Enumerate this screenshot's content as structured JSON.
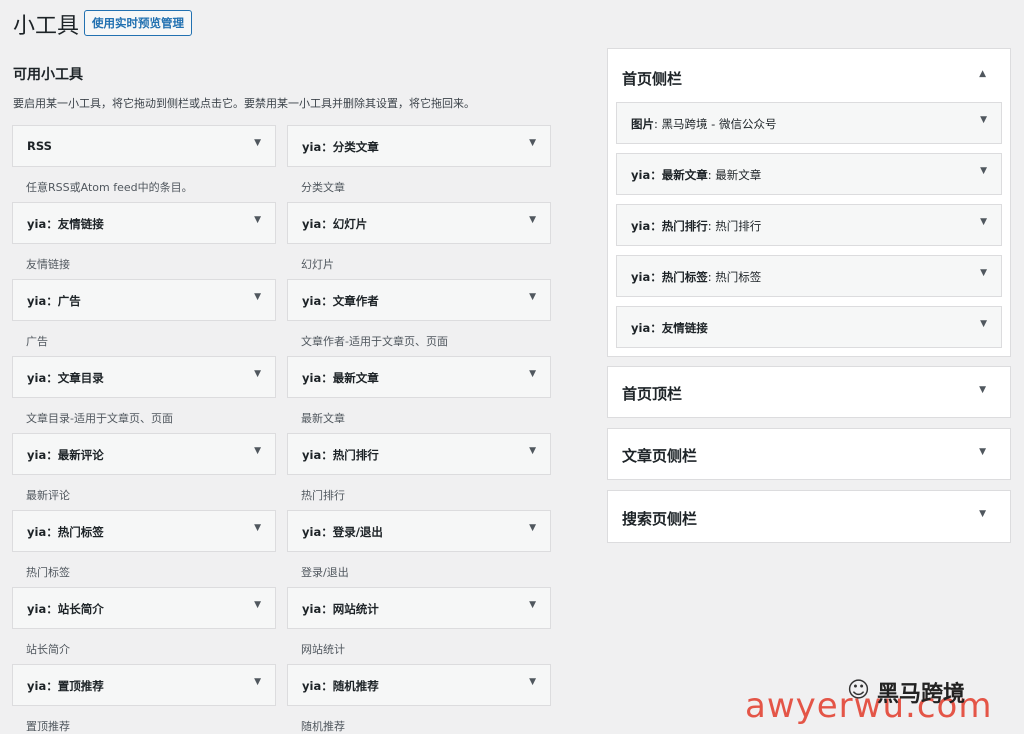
{
  "header": {
    "title": "小工具",
    "preview_button": "使用实时预览管理"
  },
  "available": {
    "title": "可用小工具",
    "description": "要启用某一小工具，将它拖动到侧栏或点击它。要禁用某一小工具并删除其设置，将它拖回来。",
    "widgets": [
      {
        "name": "RSS",
        "desc": "任意RSS或Atom feed中的条目。"
      },
      {
        "name": "yia：分类文章",
        "desc": "分类文章"
      },
      {
        "name": "yia：友情链接",
        "desc": "友情链接"
      },
      {
        "name": "yia：幻灯片",
        "desc": "幻灯片"
      },
      {
        "name": "yia：广告",
        "desc": "广告"
      },
      {
        "name": "yia：文章作者",
        "desc": "文章作者-适用于文章页、页面"
      },
      {
        "name": "yia：文章目录",
        "desc": "文章目录-适用于文章页、页面"
      },
      {
        "name": "yia：最新文章",
        "desc": "最新文章"
      },
      {
        "name": "yia：最新评论",
        "desc": "最新评论"
      },
      {
        "name": "yia：热门排行",
        "desc": "热门排行"
      },
      {
        "name": "yia：热门标签",
        "desc": "热门标签"
      },
      {
        "name": "yia：登录/退出",
        "desc": "登录/退出"
      },
      {
        "name": "yia：站长简介",
        "desc": "站长简介"
      },
      {
        "name": "yia：网站统计",
        "desc": "网站统计"
      },
      {
        "name": "yia：置顶推荐",
        "desc": "置顶推荐"
      },
      {
        "name": "yia：随机推荐",
        "desc": "随机推荐"
      }
    ]
  },
  "sidebars": [
    {
      "title": "首页侧栏",
      "expanded": true,
      "widgets": [
        {
          "name": "图片",
          "title": ": 黑马跨境 - 微信公众号"
        },
        {
          "name": "yia：最新文章",
          "title": ": 最新文章"
        },
        {
          "name": "yia：热门排行",
          "title": ": 热门排行"
        },
        {
          "name": "yia：热门标签",
          "title": ": 热门标签"
        },
        {
          "name": "yia：友情链接",
          "title": ""
        }
      ]
    },
    {
      "title": "首页顶栏",
      "expanded": false
    },
    {
      "title": "文章页侧栏",
      "expanded": false
    },
    {
      "title": "搜索页侧栏",
      "expanded": false
    }
  ],
  "icons": {
    "collapse": "▲",
    "expand": "▼"
  },
  "watermark": {
    "brand": "黑马跨境",
    "url": "awyerwu.com",
    "icon": "☺"
  }
}
